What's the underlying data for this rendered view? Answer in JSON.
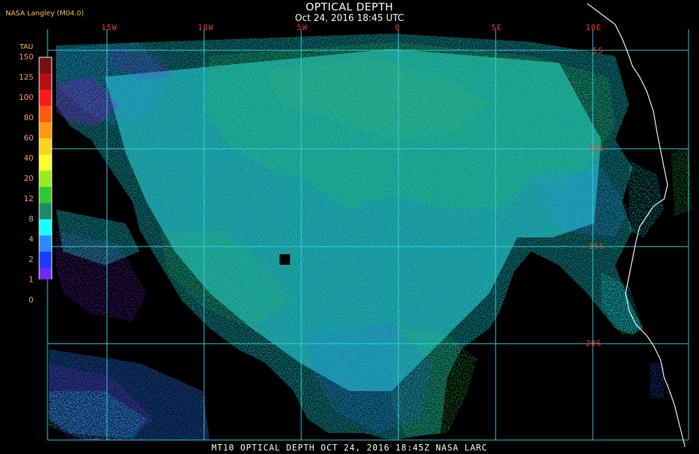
{
  "header": {
    "title": "OPTICAL DEPTH",
    "subtitle": "Oct 24, 2016 18:45 UTC",
    "producer": "NASA Langley (M04.0)"
  },
  "legend": {
    "title": "TAU",
    "ticks": [
      "150",
      "125",
      "100",
      "80",
      "60",
      "40",
      "20",
      "12",
      "8",
      "4",
      "2",
      "1",
      "0"
    ],
    "colors": [
      "#7a1010",
      "#b81010",
      "#ff1a1a",
      "#ff5a10",
      "#ff9a10",
      "#ffd21a",
      "#ffff2a",
      "#9aeb20",
      "#30c830",
      "#1a8a6a",
      "#1affff",
      "#2a8aff",
      "#1a3aff",
      "#6a2aff",
      "#9a2ae6"
    ]
  },
  "map": {
    "longitude_labels": [
      "15W",
      "10W",
      "5W",
      "0",
      "5E",
      "10E"
    ],
    "latitude_labels": [
      "5S",
      "10S",
      "15S",
      "20S"
    ],
    "grid_color": "#3ad0e6",
    "label_color": "#ff3a2a",
    "coast_color": "#ffffff"
  },
  "footer": {
    "text": "MT10  OPTICAL DEPTH   OCT 24, 2016 18:45Z   NASA LARC"
  }
}
